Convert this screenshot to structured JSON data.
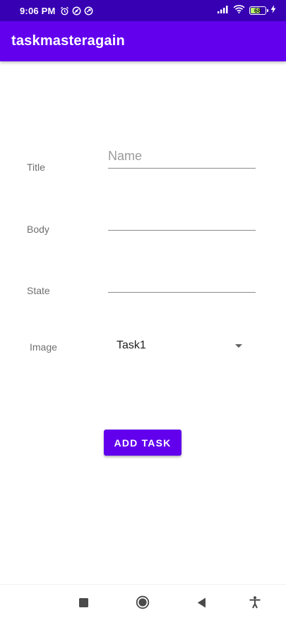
{
  "status_bar": {
    "time": "9:06 PM",
    "battery_level": "68",
    "battery_fill_percent": 68,
    "background_color": "#3700b3",
    "left_icons": [
      "alarm-icon",
      "vpn-icon",
      "sync-icon"
    ],
    "right_icons": [
      "signal-icon",
      "wifi-icon",
      "battery-icon",
      "charging-icon"
    ]
  },
  "app_bar": {
    "title": "taskmasteragain",
    "color": "#6200ee"
  },
  "form": {
    "title_label": "Title",
    "title_placeholder": "Name",
    "title_value": "",
    "body_label": "Body",
    "body_value": "",
    "state_label": "State",
    "state_value": "",
    "image_label": "Image",
    "image_selected": "Task1"
  },
  "actions": {
    "add_task_label": "ADD TASK"
  },
  "nav_bar": {
    "buttons": [
      "recents-icon",
      "home-icon",
      "back-icon",
      "accessibility-icon"
    ]
  }
}
